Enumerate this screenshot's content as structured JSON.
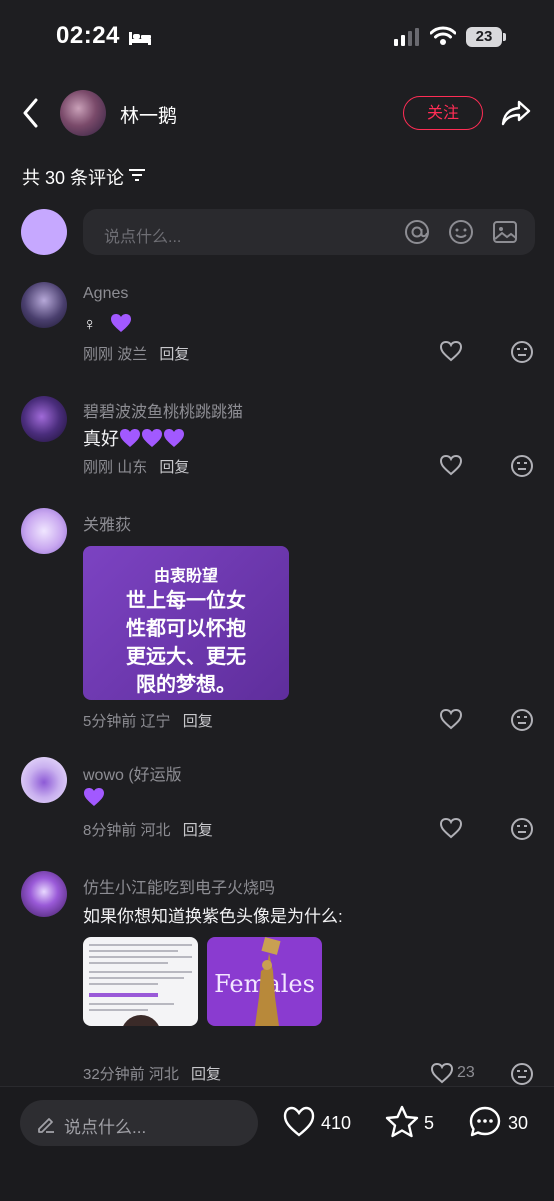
{
  "status_bar": {
    "time": "02:24",
    "battery": "23"
  },
  "header": {
    "name": "林一鹅",
    "follow_label": "关注"
  },
  "comments_header": {
    "count_label": "共 30 条评论"
  },
  "comment_input": {
    "placeholder": "说点什么..."
  },
  "comments": [
    {
      "user": "Agnes",
      "text": "♀",
      "hearts": 1,
      "time": "刚刚",
      "location": "波兰",
      "reply": "回复"
    },
    {
      "user": "碧碧波波鱼桃桃跳跳猫",
      "text": "真好",
      "hearts": 3,
      "time": "刚刚",
      "location": "山东",
      "reply": "回复"
    },
    {
      "user": "关雅荻",
      "time": "5分钟前",
      "location": "辽宁",
      "reply": "回复",
      "image": {
        "title": "由衷盼望",
        "body": [
          "世上每一位女",
          "性都可以怀抱",
          "更远大、更无",
          "限的梦想。"
        ]
      }
    },
    {
      "user": "wowo (好运版",
      "hearts": 1,
      "time": "8分钟前",
      "location": "河北",
      "reply": "回复"
    },
    {
      "user": "仿生小江能吃到电子火烧吗",
      "text": "如果你想知道换紫色头像是为什么:",
      "time": "32分钟前",
      "location": "河北",
      "reply": "回复",
      "likes": "23",
      "images": [
        {
          "kind": "document"
        },
        {
          "kind": "poster",
          "text": "Females"
        }
      ]
    }
  ],
  "bottom_bar": {
    "placeholder": "说点什么...",
    "likes": "410",
    "stars": "5",
    "comments": "30"
  },
  "colors": {
    "accent": "#ff2d55",
    "purple": "#a259ff"
  }
}
